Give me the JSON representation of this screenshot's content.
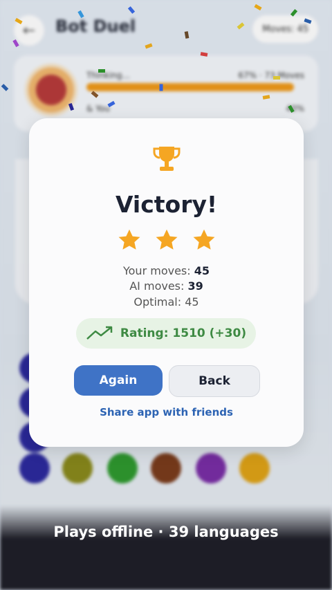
{
  "background": {
    "title": "Bot Duel",
    "moves_pill": "Moves: 45",
    "thinking": "Thinking...",
    "opponent_progress": "67% · 73 Moves",
    "you_label": "& You",
    "you_progress": "40%"
  },
  "modal": {
    "heading": "Victory!",
    "stars": 3,
    "your_moves_label": "Your moves: ",
    "your_moves_value": "45",
    "ai_moves_label": "AI moves: ",
    "ai_moves_value": "39",
    "optimal": "Optimal: 45",
    "rating": "Rating: 1510 (+30)",
    "again_label": "Again",
    "back_label": "Back",
    "share_label": "Share app with friends"
  },
  "caption": "Plays offline · 39 languages",
  "colors": {
    "accent": "#3f73c6",
    "gold": "#f5a623",
    "rating_green": "#3e8a43"
  }
}
